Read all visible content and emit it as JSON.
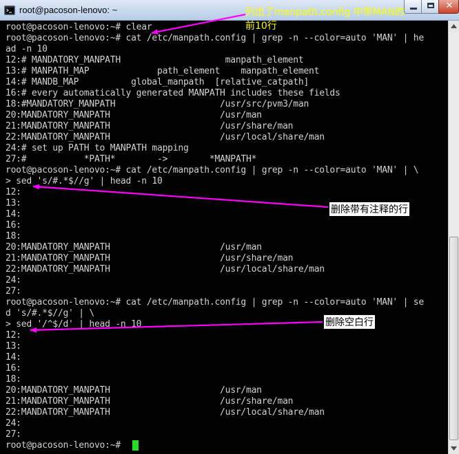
{
  "window": {
    "title": "root@pacoson-lenovo: ~",
    "minimize_label": "",
    "maximize_label": "",
    "close_label": "✕"
  },
  "terminal": {
    "lines": [
      "root@pacoson-lenovo:~# clear",
      "root@pacoson-lenovo:~# cat /etc/manpath.config | grep -n --color=auto 'MAN' | he",
      "ad -n 10",
      "12:# MANDATORY_MANPATH                    manpath_element",
      "13:# MANPATH_MAP             path_element    manpath_element",
      "14:# MANDB_MAP          global_manpath  [relative_catpath]",
      "16:# every automatically generated MANPATH includes these fields",
      "18:#MANDATORY_MANPATH                    /usr/src/pvm3/man",
      "20:MANDATORY_MANPATH                     /usr/man",
      "21:MANDATORY_MANPATH                     /usr/share/man",
      "22:MANDATORY_MANPATH                     /usr/local/share/man",
      "24:# set up PATH to MANPATH mapping",
      "27:#           *PATH*        ->        *MANPATH*",
      "root@pacoson-lenovo:~# cat /etc/manpath.config | grep -n --color=auto 'MAN' | \\",
      "> sed 's/#.*$//g' | head -n 10",
      "12:",
      "13:",
      "14:",
      "16:",
      "18:",
      "20:MANDATORY_MANPATH                     /usr/man",
      "21:MANDATORY_MANPATH                     /usr/share/man",
      "22:MANDATORY_MANPATH                     /usr/local/share/man",
      "24:",
      "27:",
      "root@pacoson-lenovo:~# cat /etc/manpath.config | grep -n --color=auto 'MAN' | se",
      "d 's/#.*$//g' | \\",
      "> sed '/^$/d' | head -n 10",
      "12:",
      "13:",
      "14:",
      "16:",
      "18:",
      "20:MANDATORY_MANPATH                     /usr/man",
      "21:MANDATORY_MANPATH                     /usr/share/man",
      "22:MANDATORY_MANPATH                     /usr/local/share/man",
      "24:",
      "27:",
      "root@pacoson-lenovo:~# "
    ]
  },
  "annotations": {
    "note1": "列出了manpath.config 中带MAN的前10行",
    "note2": "删除带有注释的行",
    "note3": "删除空白行",
    "arrow_color": "#ff00ff",
    "note1_color": "#ffff00"
  },
  "colors": {
    "terminal_bg": "#000000",
    "terminal_fg": "#d3d3d3",
    "cursor": "#22dd22"
  }
}
